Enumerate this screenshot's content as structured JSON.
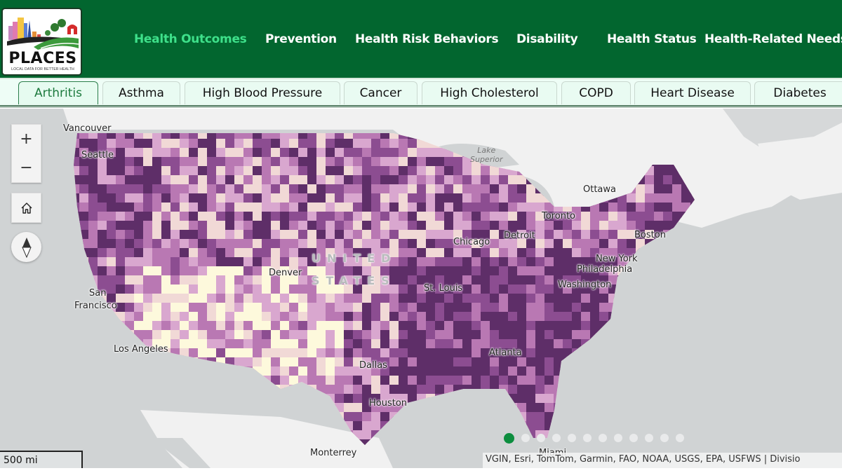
{
  "header": {
    "logo": {
      "title": "PLACES",
      "tagline": "LOCAL DATA FOR BETTER HEALTH"
    },
    "nav": [
      {
        "label": "Health Outcomes",
        "active": true
      },
      {
        "label": "Prevention",
        "active": false
      },
      {
        "label": "Health Risk Behaviors",
        "active": false
      },
      {
        "label": "Disability",
        "active": false
      },
      {
        "label": "Health Status",
        "active": false
      },
      {
        "label": "Health-Related Needs",
        "active": false
      }
    ],
    "active_color": "#3ee08a",
    "background_color": "#02662f"
  },
  "tabs": [
    {
      "label": "Arthritis",
      "active": true
    },
    {
      "label": "Asthma",
      "active": false
    },
    {
      "label": "High Blood Pressure",
      "active": false
    },
    {
      "label": "Cancer",
      "active": false
    },
    {
      "label": "High Cholesterol",
      "active": false
    },
    {
      "label": "COPD",
      "active": false
    },
    {
      "label": "Heart Disease",
      "active": false
    },
    {
      "label": "Diabetes",
      "active": false
    }
  ],
  "map": {
    "controls": {
      "zoom_in": "+",
      "zoom_out": "−",
      "home_icon": "home-icon",
      "compass_icon": "compass-icon"
    },
    "country_label": [
      "UNITED",
      "STATES"
    ],
    "lake_label": [
      "Lake",
      "Superior"
    ],
    "city_labels": [
      "Vancouver",
      "Seattle",
      "Ottawa",
      "Toronto",
      "Detroit",
      "Boston",
      "Chicago",
      "New York",
      "Philadelphia",
      "Denver",
      "Washington",
      "St. Louis",
      "San",
      "Francisco",
      "Los Angeles",
      "Atlanta",
      "Dallas",
      "Houston",
      "Miami",
      "Monterrey"
    ],
    "scale": "500 mi",
    "attribution": "VGIN, Esri, TomTom, Garmin, FAO, NOAA, USGS, EPA, USFWS | Divisio",
    "choropleth_palette": [
      "#fdf9dc",
      "#f1d9d6",
      "#d9a7cf",
      "#b978b3",
      "#8c4d91",
      "#5e2e68"
    ],
    "carousel": {
      "count": 12,
      "active_index": 0,
      "active_color": "#0c8d3e"
    }
  }
}
